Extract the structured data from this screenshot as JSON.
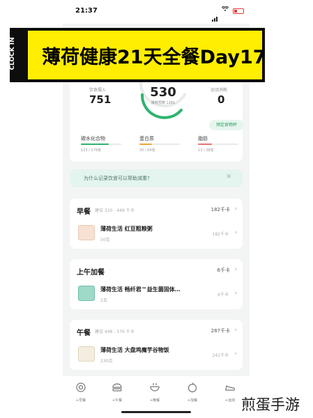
{
  "status_bar": {
    "time": "21:37"
  },
  "banner": {
    "side_label": "CLOCK IN",
    "title": "薄荷健康21天全餐Day17"
  },
  "summary": {
    "intake_label": "饮食摄入",
    "intake_value": "751",
    "remaining_value": "530",
    "remaining_sub": "推荐预算 1281",
    "exercise_label": "运动消耗",
    "exercise_value": "0",
    "custom_chip": "预定食物杯",
    "macros": [
      {
        "name": "碳水化合物",
        "detail": "123 / 179克",
        "fraction": 0.69,
        "color": "#2fb36f"
      },
      {
        "name": "蛋白质",
        "detail": "20 / 64克",
        "fraction": 0.31,
        "color": "#f0a33a"
      },
      {
        "name": "脂肪",
        "detail": "13 / 38克",
        "fraction": 0.34,
        "color": "#e57373"
      }
    ]
  },
  "tip": {
    "text": "为什么记录饮食可以帮助减重?"
  },
  "meals": [
    {
      "title": "早餐",
      "hint": "建议 320 - 448 千卡",
      "kcal": "182千卡",
      "food": {
        "name": "薄荷生活 红豆粗粮粥",
        "amount": "50克",
        "kcal": "182千卡"
      }
    },
    {
      "title": "上午加餐",
      "hint": "",
      "kcal": "6千卡",
      "food": {
        "name": "薄荷生活 畅纤君™益生菌固体…",
        "amount": "2克",
        "kcal": "6千卡"
      }
    },
    {
      "title": "午餐",
      "hint": "建议 448 - 576 千卡",
      "kcal": "287千卡",
      "food": {
        "name": "薄荷生活 大盘鸡魔芋谷物饭",
        "amount": "230克",
        "kcal": "241千卡"
      }
    }
  ],
  "tabs": [
    {
      "label": "+早餐",
      "icon": "breakfast-icon"
    },
    {
      "label": "+午餐",
      "icon": "lunch-icon"
    },
    {
      "label": "+晚餐",
      "icon": "dinner-icon"
    },
    {
      "label": "+加餐",
      "icon": "snack-icon"
    },
    {
      "label": "+运动",
      "icon": "exercise-icon"
    }
  ],
  "watermark": "煎蛋手游",
  "colors": {
    "accent": "#2fb36f",
    "banner_yellow": "#ffee00",
    "banner_border": "#0d0d0d"
  }
}
